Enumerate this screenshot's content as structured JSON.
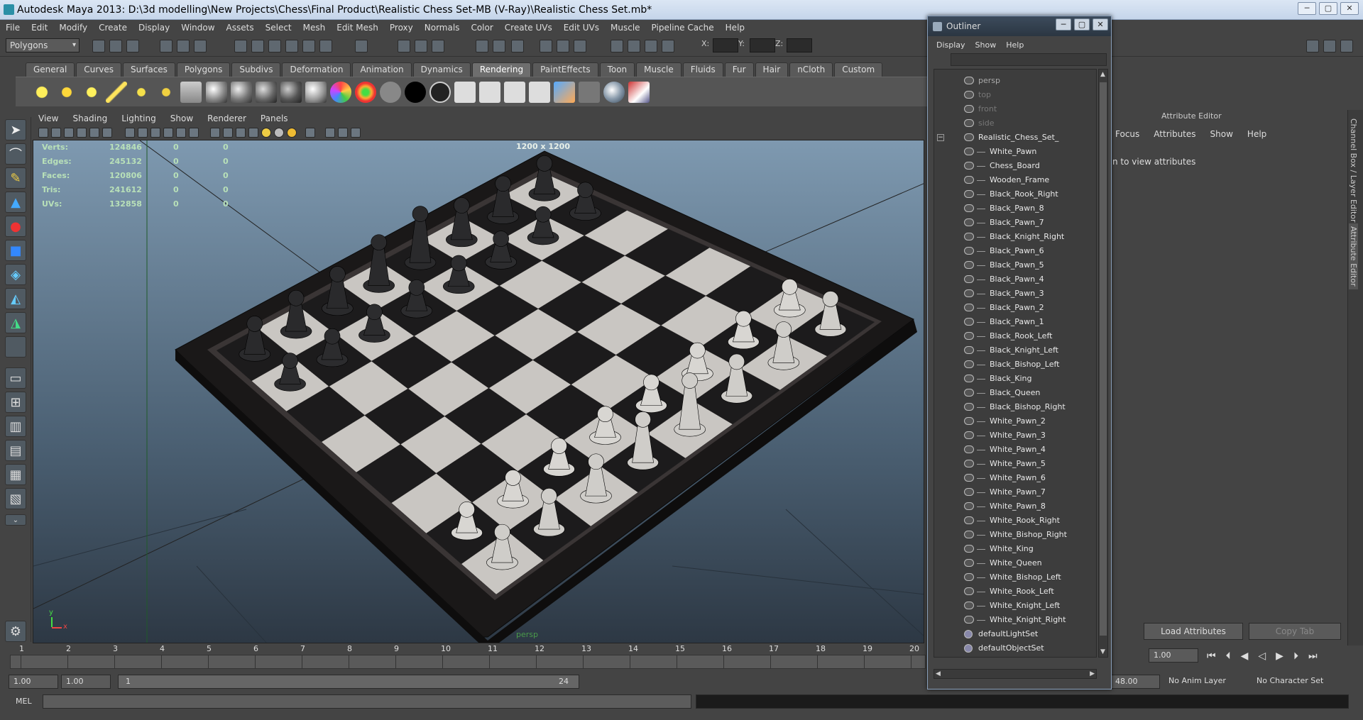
{
  "window": {
    "title": "Autodesk Maya 2013: D:\\3d modelling\\New Projects\\Chess\\Final Product\\Realistic Chess Set-MB (V-Ray)\\Realistic Chess Set.mb*",
    "min": "─",
    "max": "▢",
    "close": "✕"
  },
  "menubar": [
    "File",
    "Edit",
    "Modify",
    "Create",
    "Display",
    "Window",
    "Assets",
    "Select",
    "Mesh",
    "Edit Mesh",
    "Proxy",
    "Normals",
    "Color",
    "Create UVs",
    "Edit UVs",
    "Muscle",
    "Pipeline Cache",
    "Help"
  ],
  "status": {
    "mode": "Polygons",
    "x_label": "X:",
    "y_label": "Y:",
    "z_label": "Z:"
  },
  "shelf_tabs": [
    "General",
    "Curves",
    "Surfaces",
    "Polygons",
    "Subdivs",
    "Deformation",
    "Animation",
    "Dynamics",
    "Rendering",
    "PaintEffects",
    "Toon",
    "Muscle",
    "Fluids",
    "Fur",
    "Hair",
    "nCloth",
    "Custom"
  ],
  "shelf_active": "Rendering",
  "viewport": {
    "menu": [
      "View",
      "Shading",
      "Lighting",
      "Show",
      "Renderer",
      "Panels"
    ],
    "resolution": "1200 x 1200",
    "camera": "persp",
    "hud": [
      {
        "label": "Verts:",
        "v1": "124846",
        "v2": "0",
        "v3": "0"
      },
      {
        "label": "Edges:",
        "v1": "245132",
        "v2": "0",
        "v3": "0"
      },
      {
        "label": "Faces:",
        "v1": "120806",
        "v2": "0",
        "v3": "0"
      },
      {
        "label": "Tris:",
        "v1": "241612",
        "v2": "0",
        "v3": "0"
      },
      {
        "label": "UVs:",
        "v1": "132858",
        "v2": "0",
        "v3": "0"
      }
    ],
    "axis_y": "y",
    "axis_x": "x"
  },
  "timeline": {
    "ticks": [
      "1",
      "2",
      "3",
      "4",
      "5",
      "6",
      "7",
      "8",
      "9",
      "10",
      "11",
      "12",
      "13",
      "14",
      "15",
      "16",
      "17",
      "18",
      "19",
      "20"
    ],
    "current_frame": "1.00"
  },
  "range": {
    "start": "1.00",
    "inner_start": "1.00",
    "slider_start": "1",
    "slider_end": "24",
    "end": "48.00",
    "anim_layer": "No Anim Layer",
    "char_set": "No Character Set"
  },
  "cmdline": {
    "label": "MEL"
  },
  "attribute_editor": {
    "title": "Attribute Editor",
    "menu": [
      "Focus",
      "Attributes",
      "Show",
      "Help"
    ],
    "hint": "n to view attributes",
    "load_btn": "Load Attributes",
    "copy_btn": "Copy Tab"
  },
  "side_tabs": [
    "Channel Box / Layer Editor",
    "Attribute Editor"
  ],
  "outliner": {
    "title": "Outliner",
    "menu": [
      "Display",
      "Show",
      "Help"
    ],
    "items": [
      {
        "name": "persp",
        "type": "cam"
      },
      {
        "name": "top",
        "type": "dim"
      },
      {
        "name": "front",
        "type": "dim"
      },
      {
        "name": "side",
        "type": "dim"
      },
      {
        "name": "Realistic_Chess_Set_",
        "type": "group"
      },
      {
        "name": "White_Pawn",
        "type": "child"
      },
      {
        "name": "Chess_Board",
        "type": "child"
      },
      {
        "name": "Wooden_Frame",
        "type": "child"
      },
      {
        "name": "Black_Rook_Right",
        "type": "child"
      },
      {
        "name": "Black_Pawn_8",
        "type": "child"
      },
      {
        "name": "Black_Pawn_7",
        "type": "child"
      },
      {
        "name": "Black_Knight_Right",
        "type": "child"
      },
      {
        "name": "Black_Pawn_6",
        "type": "child"
      },
      {
        "name": "Black_Pawn_5",
        "type": "child"
      },
      {
        "name": "Black_Pawn_4",
        "type": "child"
      },
      {
        "name": "Black_Pawn_3",
        "type": "child"
      },
      {
        "name": "Black_Pawn_2",
        "type": "child"
      },
      {
        "name": "Black_Pawn_1",
        "type": "child"
      },
      {
        "name": "Black_Rook_Left",
        "type": "child"
      },
      {
        "name": "Black_Knight_Left",
        "type": "child"
      },
      {
        "name": "Black_Bishop_Left",
        "type": "child"
      },
      {
        "name": "Black_King",
        "type": "child"
      },
      {
        "name": "Black_Queen",
        "type": "child"
      },
      {
        "name": "Black_Bishop_Right",
        "type": "child"
      },
      {
        "name": "White_Pawn_2",
        "type": "child"
      },
      {
        "name": "White_Pawn_3",
        "type": "child"
      },
      {
        "name": "White_Pawn_4",
        "type": "child"
      },
      {
        "name": "White_Pawn_5",
        "type": "child"
      },
      {
        "name": "White_Pawn_6",
        "type": "child"
      },
      {
        "name": "White_Pawn_7",
        "type": "child"
      },
      {
        "name": "White_Pawn_8",
        "type": "child"
      },
      {
        "name": "White_Rook_Right",
        "type": "child"
      },
      {
        "name": "White_Bishop_Right",
        "type": "child"
      },
      {
        "name": "White_King",
        "type": "child"
      },
      {
        "name": "White_Queen",
        "type": "child"
      },
      {
        "name": "White_Bishop_Left",
        "type": "child"
      },
      {
        "name": "White_Rook_Left",
        "type": "child"
      },
      {
        "name": "White_Knight_Left",
        "type": "child"
      },
      {
        "name": "White_Knight_Right",
        "type": "child"
      },
      {
        "name": "defaultLightSet",
        "type": "set"
      },
      {
        "name": "defaultObjectSet",
        "type": "set"
      }
    ]
  }
}
